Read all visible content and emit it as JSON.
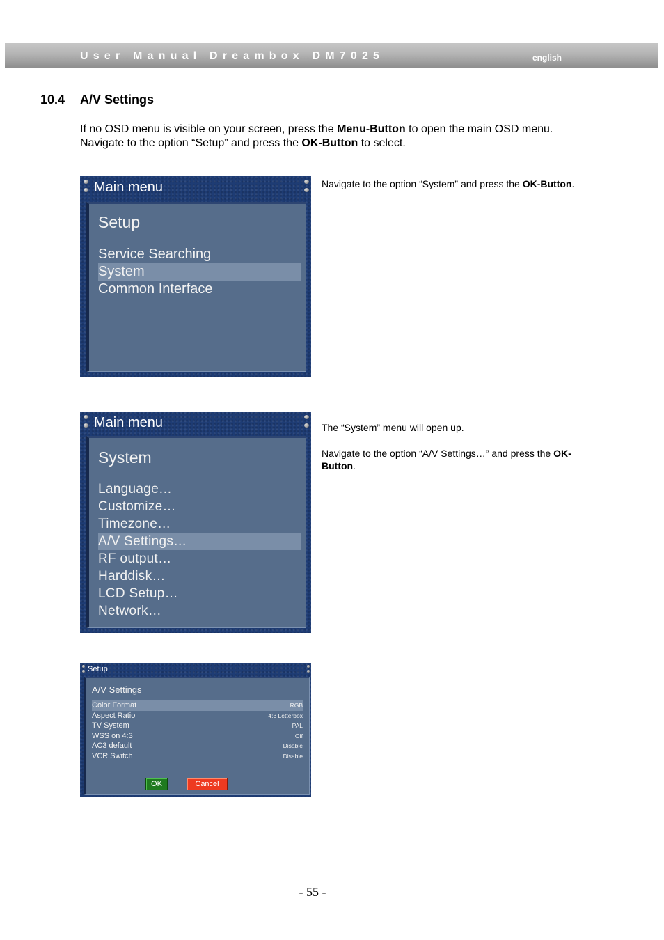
{
  "header": {
    "title": "User Manual Dreambox DM7025",
    "language": "english"
  },
  "section": {
    "number": "10.4",
    "title": "A/V Settings"
  },
  "intro": {
    "t1": "If no OSD menu is visible on your screen, press the ",
    "b1": "Menu-Button",
    "t2": " to open the main OSD menu. Navigate to the option “Setup” and press the ",
    "b2": "OK-Button",
    "t3": " to select."
  },
  "step1": {
    "osd": {
      "title": "Main menu",
      "subtitle": "Setup",
      "items": [
        "Service Searching",
        "System",
        "Common Interface"
      ],
      "selected_index": 1
    },
    "text": {
      "t1": "Navigate to the option “System” and press the ",
      "b1": "OK-Button",
      "t2": "."
    }
  },
  "step2": {
    "osd": {
      "title": "Main menu",
      "subtitle": "System",
      "items": [
        "Language…",
        "Customize…",
        "Timezone…",
        "A/V Settings…",
        "RF output…",
        "Harddisk…",
        "LCD Setup…",
        "Network…"
      ],
      "selected_index": 3
    },
    "text": {
      "p1": "The “System” menu will open up.",
      "t1": "Navigate to the option “A/V Settings…” and press the ",
      "b1": "OK-Button",
      "t2": "."
    }
  },
  "step3": {
    "osd": {
      "title": "Setup",
      "subtitle": "A/V Settings",
      "rows": [
        {
          "label": "Color Format",
          "value": "RGB"
        },
        {
          "label": "Aspect Ratio",
          "value": "4:3 Letterbox"
        },
        {
          "label": "TV System",
          "value": "PAL"
        },
        {
          "label": "WSS on 4:3",
          "value": "Off"
        },
        {
          "label": "AC3 default",
          "value": "Disable"
        },
        {
          "label": "VCR Switch",
          "value": "Disable"
        }
      ],
      "selected_index": 0,
      "ok_label": "OK",
      "cancel_label": "Cancel"
    }
  },
  "colors": {
    "osd_frame": "#1e3c74",
    "osd_panel": "#566d8b",
    "osd_highlight": "#7a8ea8",
    "ok_button": "#1f7a1f",
    "cancel_button": "#ee3a20"
  },
  "footer": {
    "page_number": "- 55 -"
  }
}
